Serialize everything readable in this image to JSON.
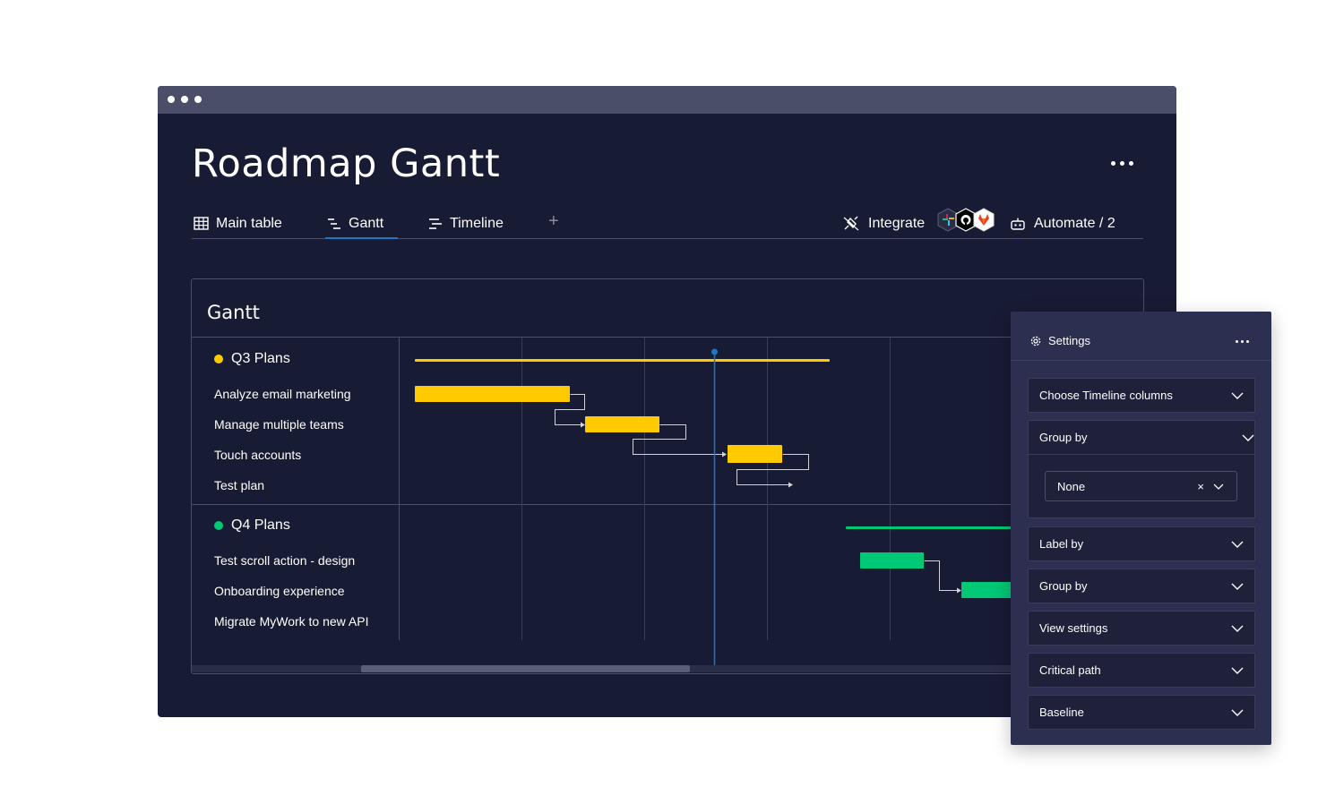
{
  "window": {
    "title": "Roadmap Gantt"
  },
  "tabs": [
    {
      "label": "Main table",
      "icon": "table-icon",
      "active": false
    },
    {
      "label": "Gantt",
      "icon": "gantt-icon",
      "active": true
    },
    {
      "label": "Timeline",
      "icon": "timeline-icon",
      "active": false
    }
  ],
  "toolbar": {
    "add_tab": "+",
    "integrate_label": "Integrate",
    "integration_icons": [
      "slack-icon",
      "github-icon",
      "gitlab-icon"
    ],
    "automate_label": "Automate / 2"
  },
  "gantt": {
    "title": "Gantt",
    "groups": [
      {
        "name": "Q3 Plans",
        "color": "#ffcb00",
        "items": [
          "Analyze email marketing",
          "Manage multiple teams",
          "Touch accounts",
          "Test plan"
        ]
      },
      {
        "name": "Q4 Plans",
        "color": "#00c875",
        "items": [
          "Test scroll action - design",
          "Onboarding experience",
          "Migrate MyWork to new API"
        ]
      }
    ],
    "today_marker_color": "#1f76c2"
  },
  "settings": {
    "title": "Settings",
    "dropdowns": [
      "Choose Timeline columns",
      "Group by",
      "Label by",
      "Group by",
      "View settings",
      "Critical path",
      "Baseline"
    ],
    "group_by_value": "None",
    "clear_symbol": "×"
  }
}
